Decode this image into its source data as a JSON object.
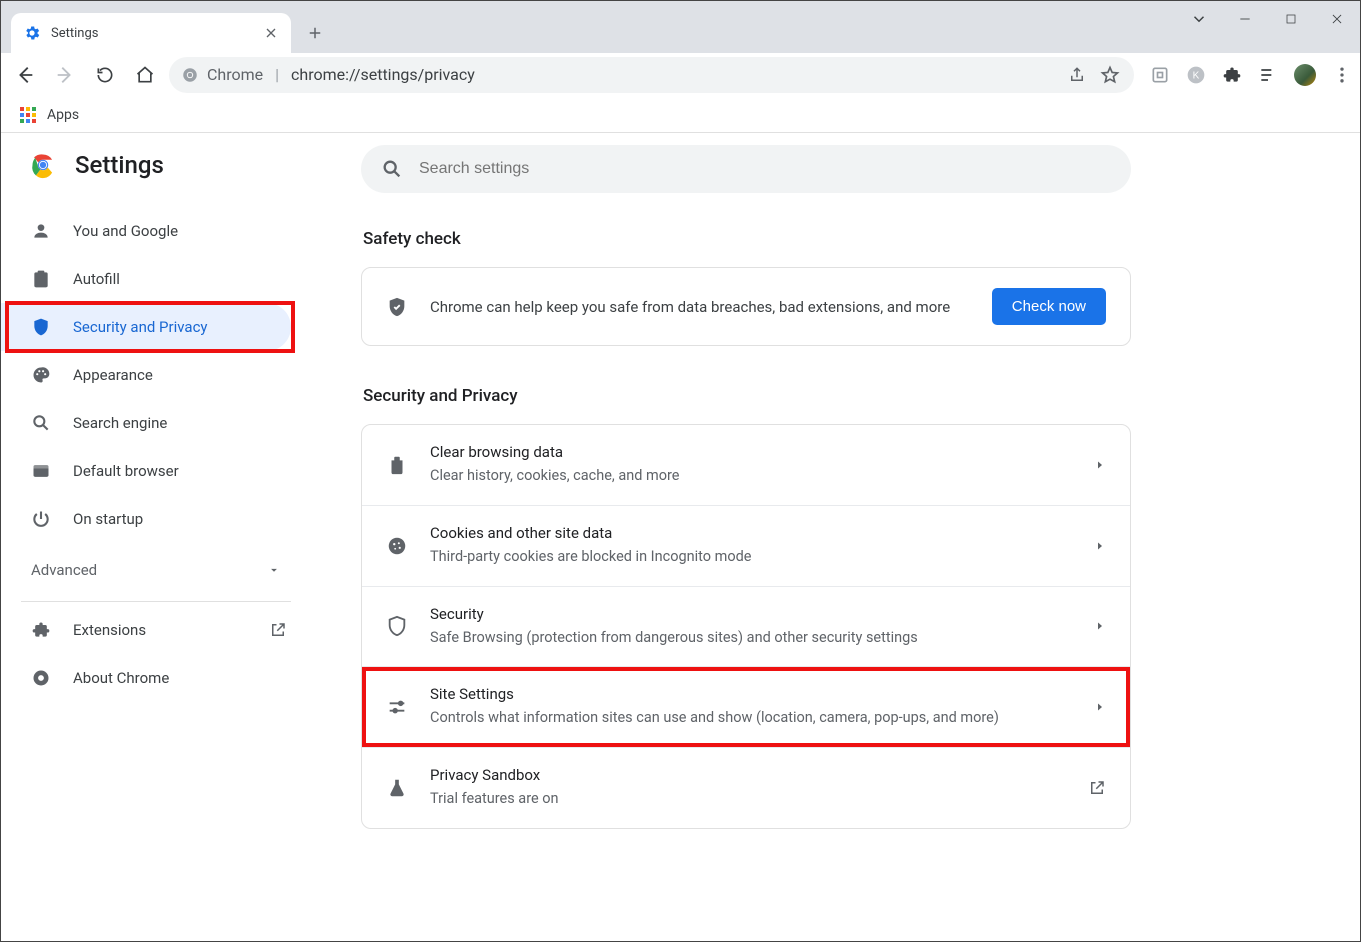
{
  "window": {
    "tab_title": "Settings",
    "omnibox_chip": "Chrome",
    "omnibox_url": "chrome://settings/privacy"
  },
  "bookmarks": {
    "apps_label": "Apps"
  },
  "sidebar": {
    "header": "Settings",
    "items": [
      {
        "label": "You and Google"
      },
      {
        "label": "Autofill"
      },
      {
        "label": "Security and Privacy",
        "active": true
      },
      {
        "label": "Appearance"
      },
      {
        "label": "Search engine"
      },
      {
        "label": "Default browser"
      },
      {
        "label": "On startup"
      }
    ],
    "advanced_label": "Advanced",
    "extensions_label": "Extensions",
    "about_label": "About Chrome"
  },
  "search": {
    "placeholder": "Search settings"
  },
  "sections": {
    "safety_title": "Safety check",
    "safety_text": "Chrome can help keep you safe from data breaches, bad extensions, and more",
    "check_now": "Check now",
    "privacy_title": "Security and Privacy",
    "rows": [
      {
        "title": "Clear browsing data",
        "sub": "Clear history, cookies, cache, and more"
      },
      {
        "title": "Cookies and other site data",
        "sub": "Third-party cookies are blocked in Incognito mode"
      },
      {
        "title": "Security",
        "sub": "Safe Browsing (protection from dangerous sites) and other security settings"
      },
      {
        "title": "Site Settings",
        "sub": "Controls what information sites can use and show (location, camera, pop-ups, and more)"
      },
      {
        "title": "Privacy Sandbox",
        "sub": "Trial features are on"
      }
    ]
  }
}
